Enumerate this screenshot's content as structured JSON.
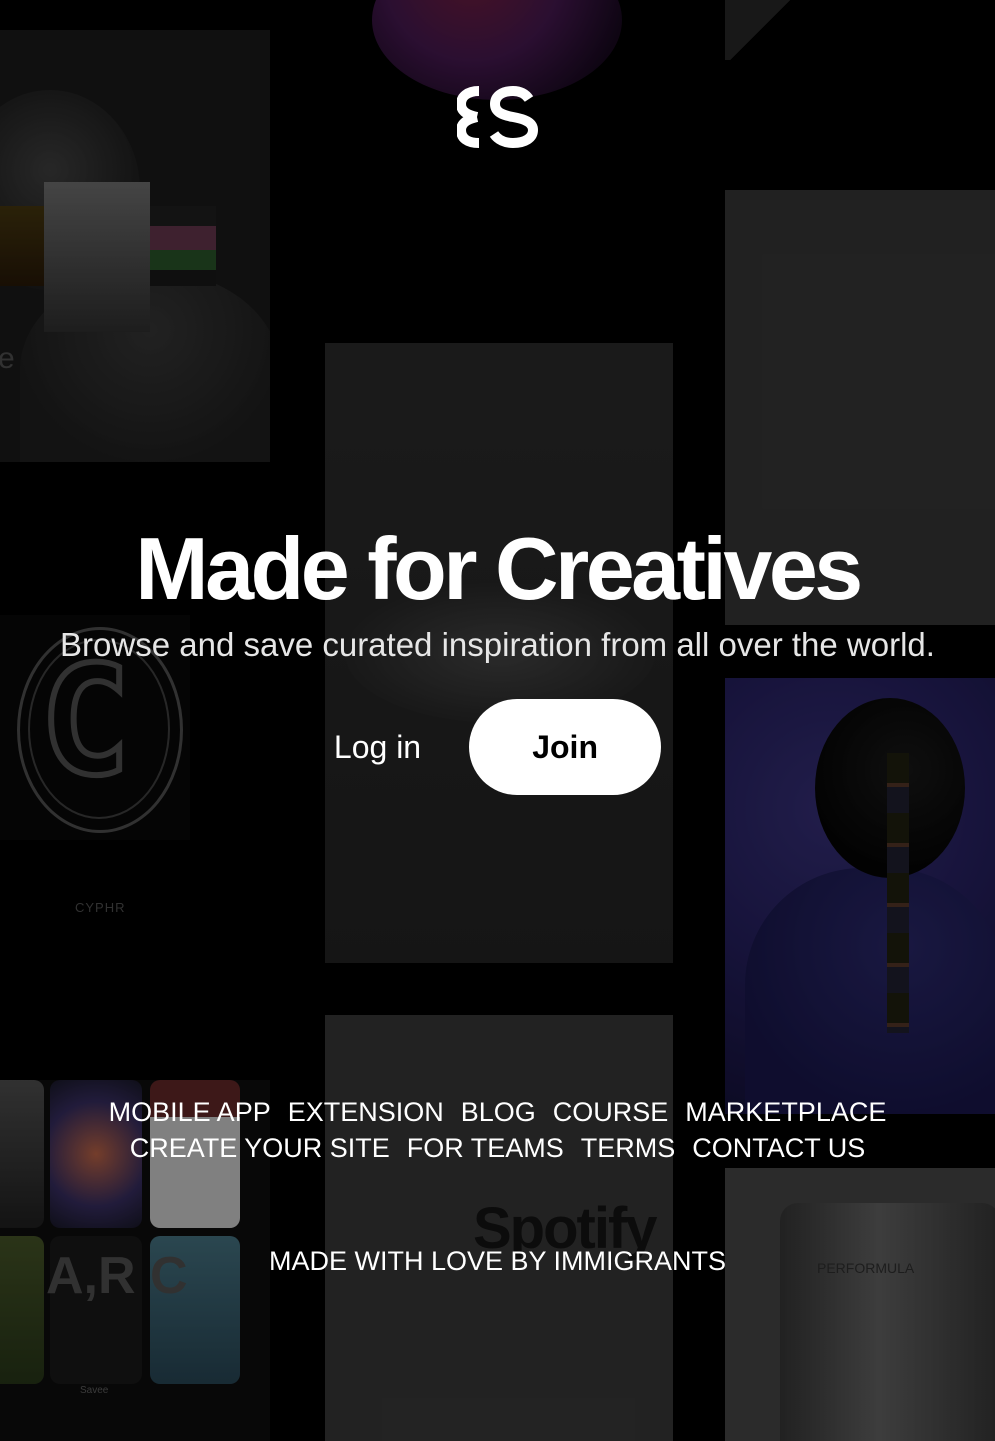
{
  "hero": {
    "title": "Made for Creatives",
    "subtitle": "Browse and save curated inspiration from all over the world."
  },
  "actions": {
    "login_label": "Log in",
    "join_label": "Join"
  },
  "footer": {
    "row1": [
      "MOBILE APP",
      "EXTENSION",
      "BLOG",
      "COURSE",
      "MARKETPLACE"
    ],
    "row2": [
      "CREATE YOUR SITE",
      "FOR TEAMS",
      "TERMS",
      "CONTACT US"
    ],
    "credit": "MADE WITH LOVE BY IMMIGRANTS"
  },
  "background_tiles": {
    "cypha_text": "CYPHR",
    "spotify_text": "Spotify",
    "performula_text": "PERFORMULA",
    "arc_text": "A,R C",
    "savee_text": "Savee",
    "edge_letter": "e"
  },
  "colors": {
    "background": "#000000",
    "join_button_bg": "#ffffff",
    "text": "#ffffff"
  }
}
